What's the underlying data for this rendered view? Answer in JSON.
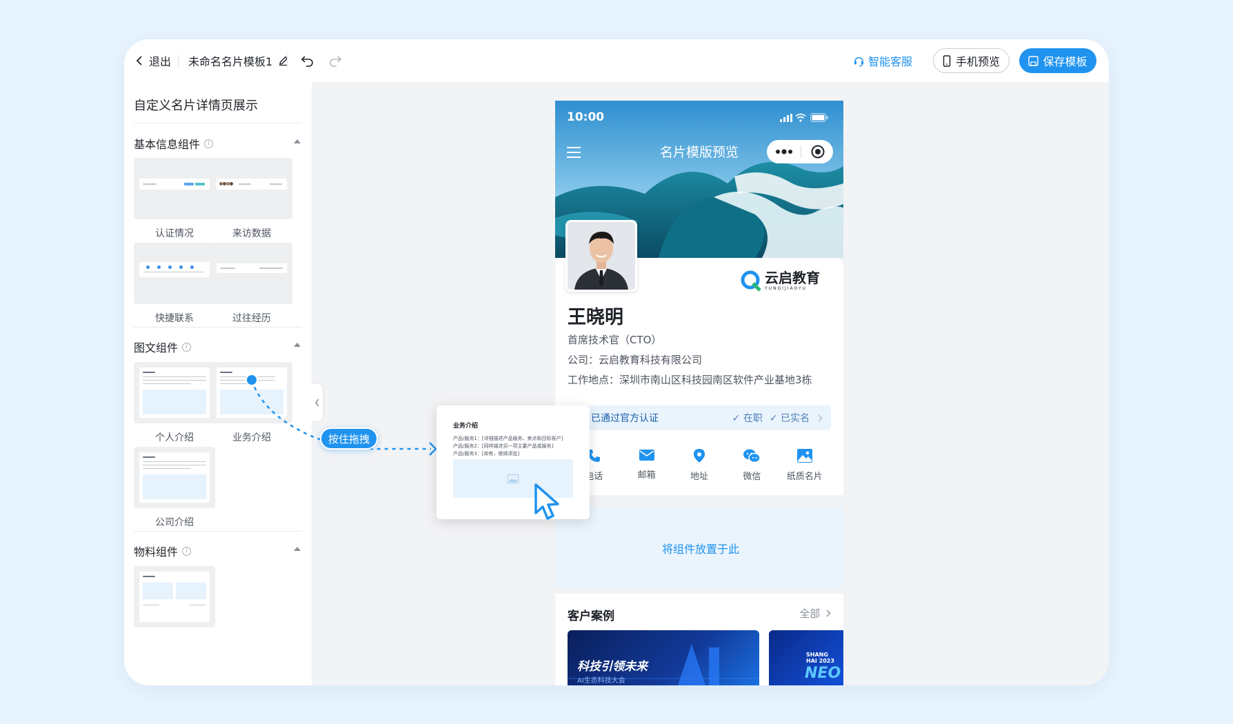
{
  "topbar": {
    "exit_label": "退出",
    "template_name": "未命名名片模板1",
    "support_label": "智能客服",
    "preview_label": "手机预览",
    "save_label": "保存模板"
  },
  "left_panel": {
    "title": "自定义名片详情页展示",
    "sections": [
      {
        "title": "基本信息组件",
        "tiles": [
          "认证情况",
          "来访数据",
          "快捷联系",
          "过往经历"
        ]
      },
      {
        "title": "图文组件",
        "tiles": [
          "个人介绍",
          "业务介绍",
          "公司介绍"
        ]
      },
      {
        "title": "物料组件",
        "tiles": []
      }
    ]
  },
  "drag": {
    "hint": "按住拖拽",
    "card_title": "业务介绍",
    "card_lines": [
      "产品/服务1：[详细描述产品服务、卖点和目标客户]",
      "产品/服务2：[同样描述另一项主要产品或服务]",
      "产品/服务3：[如有，继续添加]"
    ]
  },
  "phone": {
    "time": "10:00",
    "nav_title": "名片模版预览",
    "brand_name": "云启教育",
    "brand_pinyin": "YUNQIJIAOYU",
    "name": "王晓明",
    "title": "首席技术官（CTO）",
    "company": "公司：云启教育科技有限公司",
    "address": "工作地点：深圳市南山区科技园南区软件产业基地3栋",
    "verified": "已通过官方认证",
    "employed": "在职",
    "real_name": "已实名",
    "contacts": [
      "电话",
      "邮箱",
      "地址",
      "微信",
      "纸质名片"
    ],
    "drop_hint": "将组件放置于此",
    "cases_title": "客户案例",
    "cases_all": "全部",
    "case1_text": "科技引领未来",
    "case1_sub": "AI生态科技大会",
    "case2_text": "NEO",
    "case2_sub": "SHANG HAI 2023"
  },
  "colors": {
    "accent": "#1f93ef",
    "background": "#e7f3fd"
  }
}
